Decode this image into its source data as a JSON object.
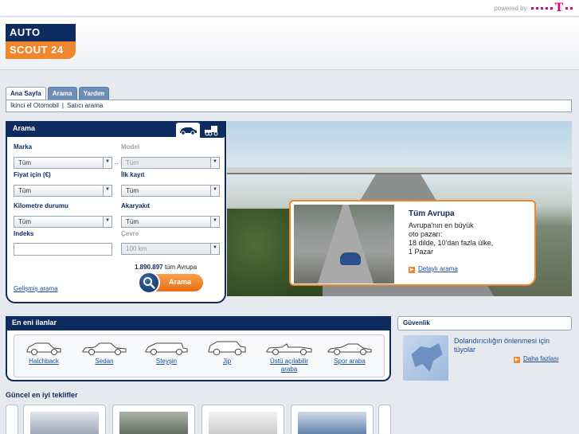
{
  "topbar": {
    "powered_by": "powered by",
    "brand_letter": "T"
  },
  "logo": {
    "line1": "AUTO",
    "line2": "SCOUT 24"
  },
  "tabs": [
    {
      "label": "Ana Sayfa",
      "active": true
    },
    {
      "label": "Arama",
      "active": false
    },
    {
      "label": "Yardım",
      "active": false
    }
  ],
  "subnav": {
    "item1": "İkinci el Otomobil",
    "separator": "|",
    "item2": "Satıcı arama"
  },
  "search": {
    "title": "Arama",
    "marka_label": "Marka",
    "marka_value": "Tüm",
    "model_label": "Model",
    "model_value": "Tüm",
    "fiyat_label": "Fiyat için (€)",
    "fiyat_value": "Tüm",
    "ilk_kayit_label": "İlk kayıt",
    "ilk_kayit_value": "Tüm",
    "km_label": "Kilometre durumu",
    "km_value": "Tüm",
    "yakit_label": "Akaryakıt",
    "yakit_value": "Tüm",
    "indeks_label": "Indeks",
    "indeks_value": "",
    "cevre_label": "Çevre",
    "cevre_value": "100 km",
    "count_number": "1.890.897",
    "count_text": "tüm Avrupa",
    "button_label": "Arama",
    "advanced_link": "Gelişmiş arama"
  },
  "promo": {
    "title": "Tüm Avrupa",
    "line1": "Avrupa'nın en büyük",
    "line2": "oto pazarı:",
    "line3": "18 dilde, 10'dan fazla ülke,",
    "line4": "1 Pazar",
    "link": "Detaylı arama"
  },
  "newest": {
    "title": "En eni ilanlar",
    "body_types": [
      {
        "label": "Hatchback"
      },
      {
        "label": "Sedan"
      },
      {
        "label": "Steyşin"
      },
      {
        "label": "Jip"
      },
      {
        "label": "Üstü açılabilir araba"
      },
      {
        "label": "Spor araba"
      }
    ]
  },
  "security": {
    "title": "Güvenlik",
    "text": "Dolandırıcılığın önlenmesi için tüyolar",
    "link": "Daha fazlası"
  },
  "offers": {
    "title": "Güncel en iyi teklifler"
  },
  "colors": {
    "navy": "#0d2b5e",
    "orange": "#f2862d",
    "magenta": "#e20074",
    "link": "#1a4d9c"
  }
}
